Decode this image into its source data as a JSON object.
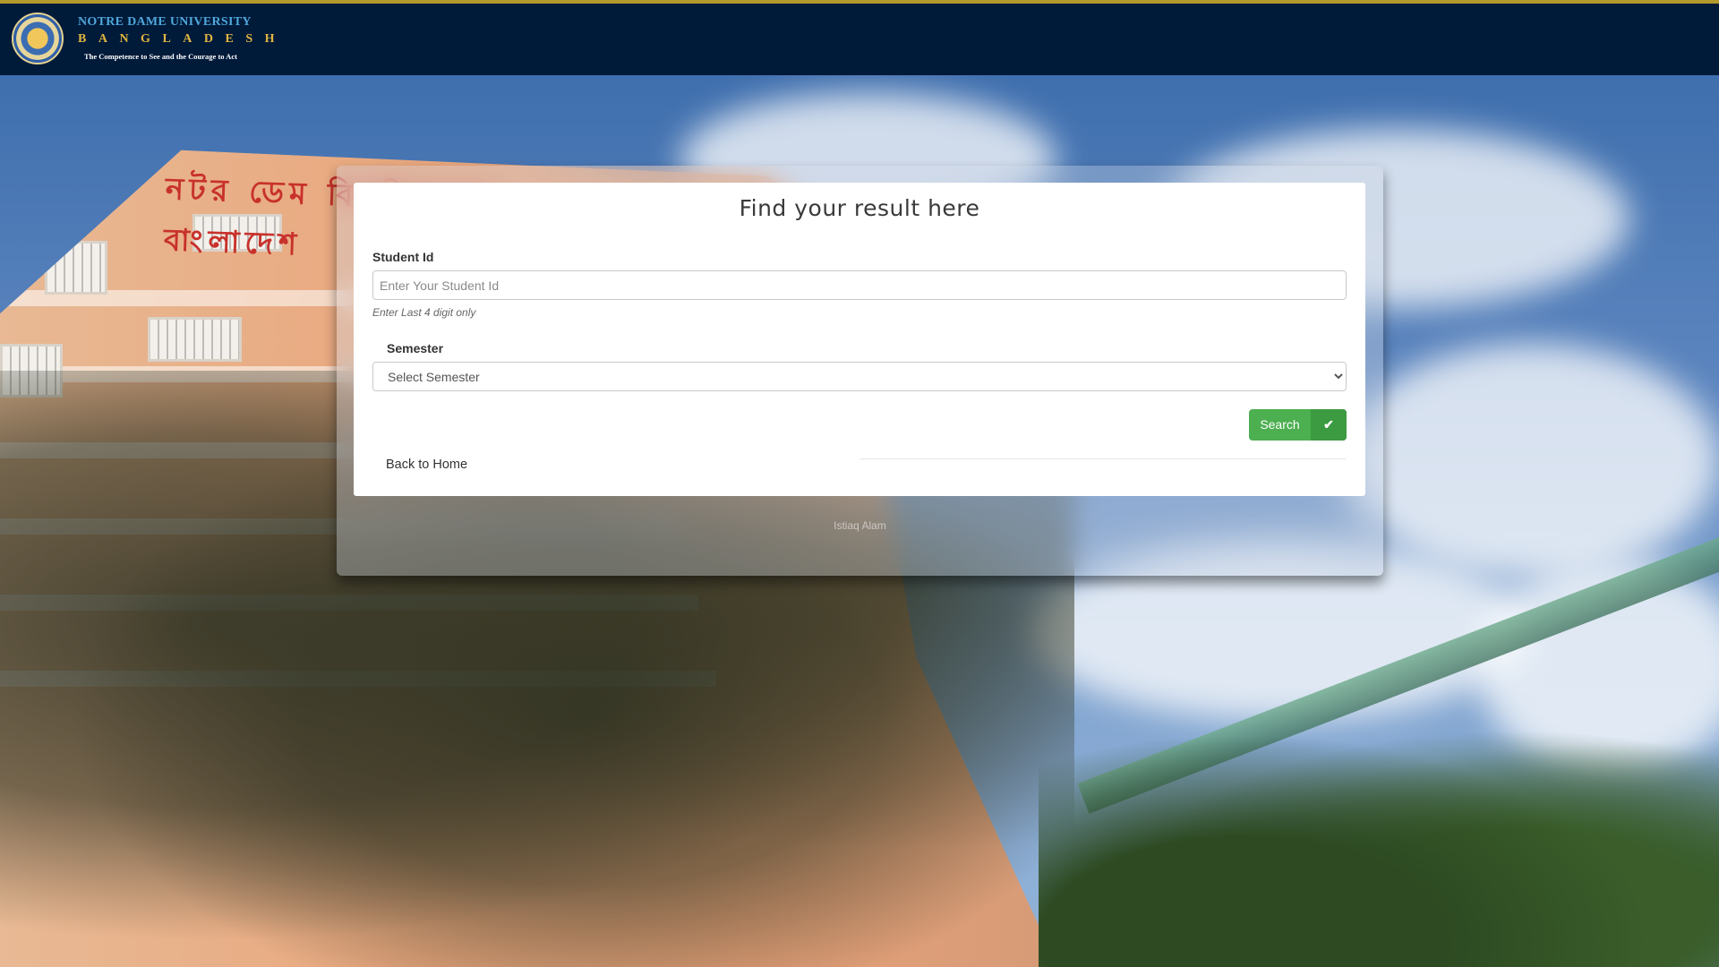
{
  "header": {
    "university_name": "NOTRE DAME UNIVERSITY",
    "country": "BANGLADESH",
    "motto": "The Competence to See and the Courage to Act"
  },
  "background": {
    "building_sign": "নটর ডেম বিশ্ববিদ্যালয় বাংলাদেশ"
  },
  "form": {
    "title": "Find your result here",
    "student_id": {
      "label": "Student Id",
      "placeholder": "Enter Your Student Id",
      "value": "",
      "hint": "Enter Last 4 digit only"
    },
    "semester": {
      "label": "Semester",
      "selected": "Select Semester"
    },
    "search_button": {
      "label": "Search",
      "icon": "checkmark-icon"
    },
    "back_link": "Back to Home"
  },
  "footer": {
    "text": "Istiaq Alam"
  },
  "colors": {
    "header_bg": "#001a3a",
    "header_accent": "#b49a2c",
    "brand_blue": "#4ea8dc",
    "brand_gold": "#e0b640",
    "button_green": "#4caf50"
  }
}
